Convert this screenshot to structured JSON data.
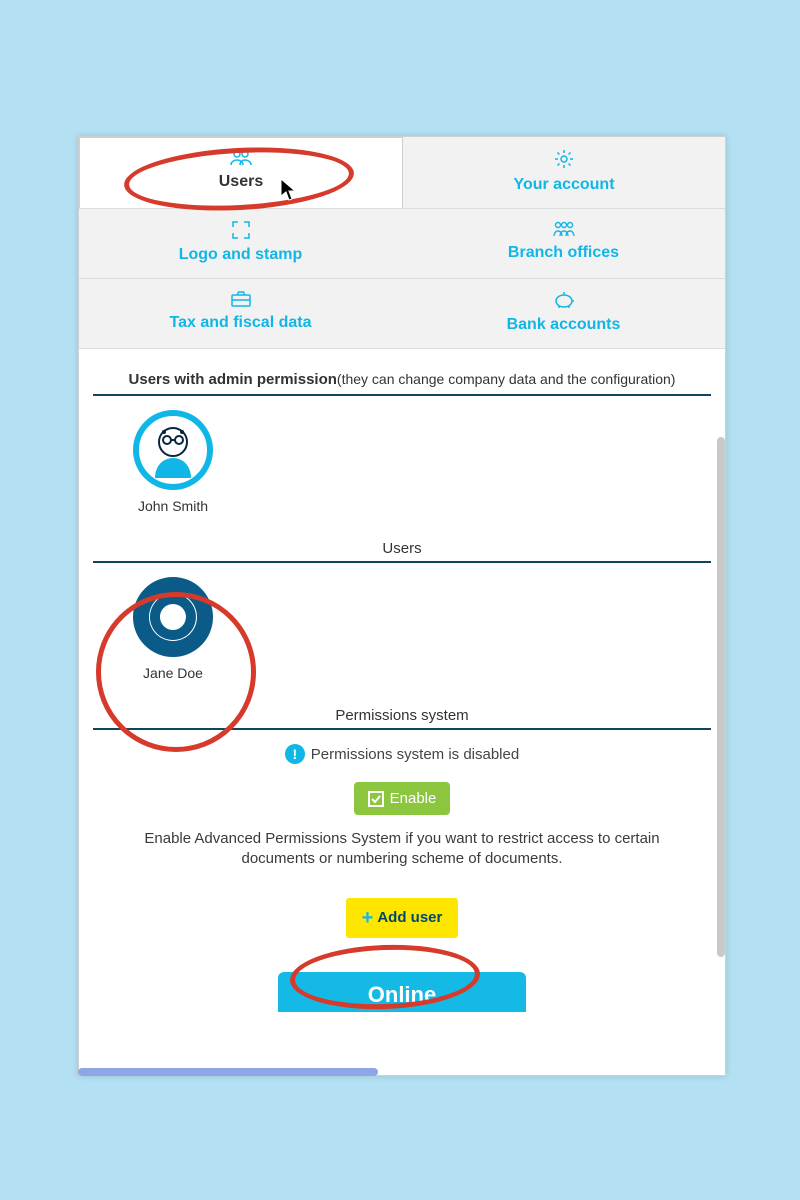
{
  "tabs": {
    "users": "Users",
    "account": "Your account",
    "logo": "Logo and stamp",
    "branch": "Branch offices",
    "tax": "Tax and fiscal data",
    "bank": "Bank accounts"
  },
  "sections": {
    "admin_title_bold": "Users with admin permission",
    "admin_title_sub": "(they can change company data and the configuration)",
    "users_heading": "Users",
    "permissions_heading": "Permissions system"
  },
  "users": {
    "admin_user": "John Smith",
    "regular_user": "Jane Doe"
  },
  "permissions": {
    "status_text": "Permissions system is disabled",
    "enable_label": "Enable",
    "description": "Enable Advanced Permissions System if you want to restrict access to certain documents or numbering scheme of documents."
  },
  "buttons": {
    "add_user": "Add user"
  },
  "footer": {
    "online": "Online"
  }
}
